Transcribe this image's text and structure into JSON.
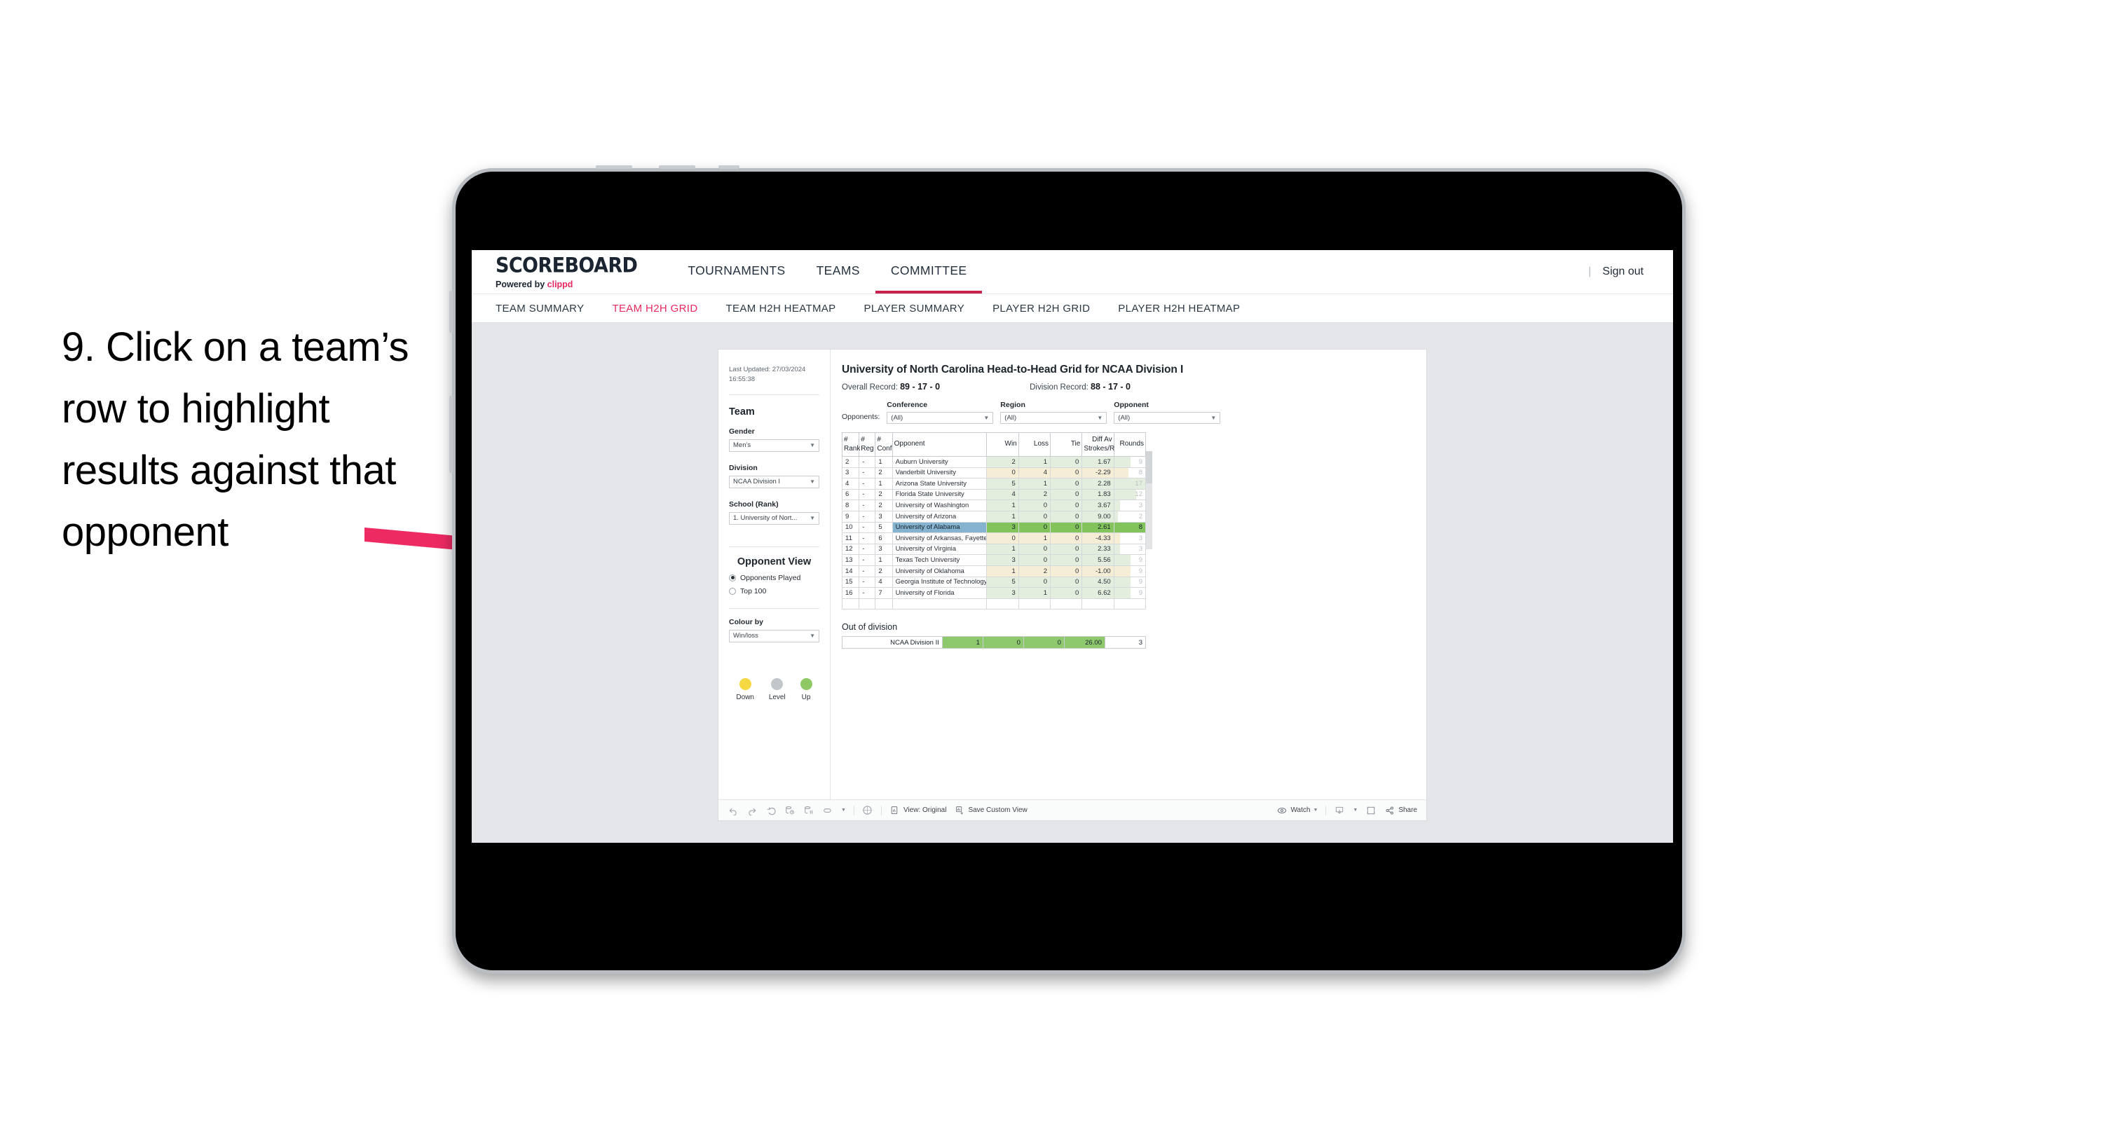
{
  "annotation": {
    "text": "9. Click on a team’s row to highlight results against that opponent",
    "arrow_color": "#ee2a63"
  },
  "app": {
    "brand": {
      "wordmark": "SCOREBOARD",
      "powered_prefix": "Powered by ",
      "powered_brand": "clippd"
    },
    "topnav": [
      {
        "label": "TOURNAMENTS",
        "active": false
      },
      {
        "label": "TEAMS",
        "active": false
      },
      {
        "label": "COMMITTEE",
        "active": true
      }
    ],
    "signout": {
      "divider": "|",
      "label": "Sign out"
    },
    "subnav": [
      {
        "label": "TEAM SUMMARY",
        "active": false
      },
      {
        "label": "TEAM H2H GRID",
        "active": true
      },
      {
        "label": "TEAM H2H HEATMAP",
        "active": false
      },
      {
        "label": "PLAYER SUMMARY",
        "active": false
      },
      {
        "label": "PLAYER H2H GRID",
        "active": false
      },
      {
        "label": "PLAYER H2H HEATMAP",
        "active": false
      }
    ]
  },
  "sidebar": {
    "last_updated": "Last Updated: 27/03/2024 16:55:38",
    "team_heading": "Team",
    "gender": {
      "label": "Gender",
      "value": "Men’s"
    },
    "division": {
      "label": "Division",
      "value": "NCAA Division I"
    },
    "school": {
      "label": "School (Rank)",
      "value": "1. University of Nort..."
    },
    "opponent_view": {
      "heading": "Opponent View",
      "options": [
        {
          "label": "Opponents Played",
          "selected": true
        },
        {
          "label": "Top 100",
          "selected": false
        }
      ]
    },
    "colour_by": {
      "label": "Colour by",
      "value": "Win/loss"
    },
    "legend": [
      {
        "label": "Down",
        "color": "#f5d842"
      },
      {
        "label": "Level",
        "color": "#c3c7ca"
      },
      {
        "label": "Up",
        "color": "#8fc966"
      }
    ]
  },
  "main": {
    "title": "University of North Carolina Head-to-Head Grid for NCAA Division I",
    "overall_record": {
      "label": "Overall Record: ",
      "value": "89 - 17 - 0"
    },
    "division_record": {
      "label": "Division Record: ",
      "value": "88 - 17 - 0"
    },
    "opponents_label": "Opponents:",
    "filters": [
      {
        "label": "Conference",
        "value": "(All)"
      },
      {
        "label": "Region",
        "value": "(All)"
      },
      {
        "label": "Opponent",
        "value": "(All)"
      }
    ],
    "columns": {
      "rank": "# Rank",
      "reg": "# Reg",
      "conf": "# Conf",
      "opponent": "Opponent",
      "win": "Win",
      "loss": "Loss",
      "tie": "Tie",
      "diff": "Diff Av Strokes/Rnd",
      "rounds": "Rounds"
    },
    "rows": [
      {
        "rank": "2",
        "reg": "-",
        "conf": "1",
        "opponent": "Auburn University",
        "win": "2",
        "loss": "1",
        "tie": "0",
        "diff": "1.67",
        "rounds": "9",
        "tone": "up",
        "highlight": false
      },
      {
        "rank": "3",
        "reg": "-",
        "conf": "2",
        "opponent": "Vanderbilt University",
        "win": "0",
        "loss": "4",
        "tie": "0",
        "diff": "-2.29",
        "rounds": "8",
        "tone": "down",
        "highlight": false
      },
      {
        "rank": "4",
        "reg": "-",
        "conf": "1",
        "opponent": "Arizona State University",
        "win": "5",
        "loss": "1",
        "tie": "0",
        "diff": "2.28",
        "rounds": "17",
        "tone": "up",
        "highlight": false
      },
      {
        "rank": "6",
        "reg": "-",
        "conf": "2",
        "opponent": "Florida State University",
        "win": "4",
        "loss": "2",
        "tie": "0",
        "diff": "1.83",
        "rounds": "12",
        "tone": "up",
        "highlight": false
      },
      {
        "rank": "8",
        "reg": "-",
        "conf": "2",
        "opponent": "University of Washington",
        "win": "1",
        "loss": "0",
        "tie": "0",
        "diff": "3.67",
        "rounds": "3",
        "tone": "up",
        "highlight": false
      },
      {
        "rank": "9",
        "reg": "-",
        "conf": "3",
        "opponent": "University of Arizona",
        "win": "1",
        "loss": "0",
        "tie": "0",
        "diff": "9.00",
        "rounds": "2",
        "tone": "up",
        "highlight": false
      },
      {
        "rank": "10",
        "reg": "-",
        "conf": "5",
        "opponent": "University of Alabama",
        "win": "3",
        "loss": "0",
        "tie": "0",
        "diff": "2.61",
        "rounds": "8",
        "tone": "up",
        "highlight": true
      },
      {
        "rank": "11",
        "reg": "-",
        "conf": "6",
        "opponent": "University of Arkansas, Fayetteville",
        "win": "0",
        "loss": "1",
        "tie": "0",
        "diff": "-4.33",
        "rounds": "3",
        "tone": "down",
        "highlight": false
      },
      {
        "rank": "12",
        "reg": "-",
        "conf": "3",
        "opponent": "University of Virginia",
        "win": "1",
        "loss": "0",
        "tie": "0",
        "diff": "2.33",
        "rounds": "3",
        "tone": "up",
        "highlight": false
      },
      {
        "rank": "13",
        "reg": "-",
        "conf": "1",
        "opponent": "Texas Tech University",
        "win": "3",
        "loss": "0",
        "tie": "0",
        "diff": "5.56",
        "rounds": "9",
        "tone": "up",
        "highlight": false
      },
      {
        "rank": "14",
        "reg": "-",
        "conf": "2",
        "opponent": "University of Oklahoma",
        "win": "1",
        "loss": "2",
        "tie": "0",
        "diff": "-1.00",
        "rounds": "9",
        "tone": "down",
        "highlight": false
      },
      {
        "rank": "15",
        "reg": "-",
        "conf": "4",
        "opponent": "Georgia Institute of Technology",
        "win": "5",
        "loss": "0",
        "tie": "0",
        "diff": "4.50",
        "rounds": "9",
        "tone": "up",
        "highlight": false
      },
      {
        "rank": "16",
        "reg": "-",
        "conf": "7",
        "opponent": "University of Florida",
        "win": "3",
        "loss": "1",
        "tie": "0",
        "diff": "6.62",
        "rounds": "9",
        "tone": "up",
        "highlight": false
      }
    ],
    "out_of_division": {
      "title": "Out of division",
      "row": {
        "label": "NCAA Division II",
        "win": "1",
        "loss": "0",
        "tie": "0",
        "diff": "26.00",
        "rounds": "3"
      }
    }
  },
  "toolbar": {
    "icons_left": [
      "undo-icon",
      "redo-icon",
      "revert-icon",
      "refresh-icon",
      "pause-icon",
      "resize-icon"
    ],
    "view_original": "View: Original",
    "save_custom_view": "Save Custom View",
    "watch": "Watch",
    "share": "Share"
  },
  "colors": {
    "accent_pink": "#e8285f",
    "active_tab_underline": "#c9204d",
    "highlight_row_label": "#85b3cf",
    "highlight_row_value": "#82c35c",
    "up_tint": "#e3eede",
    "down_tint": "#f6edd6",
    "screen_bg": "#e4e6e9"
  }
}
